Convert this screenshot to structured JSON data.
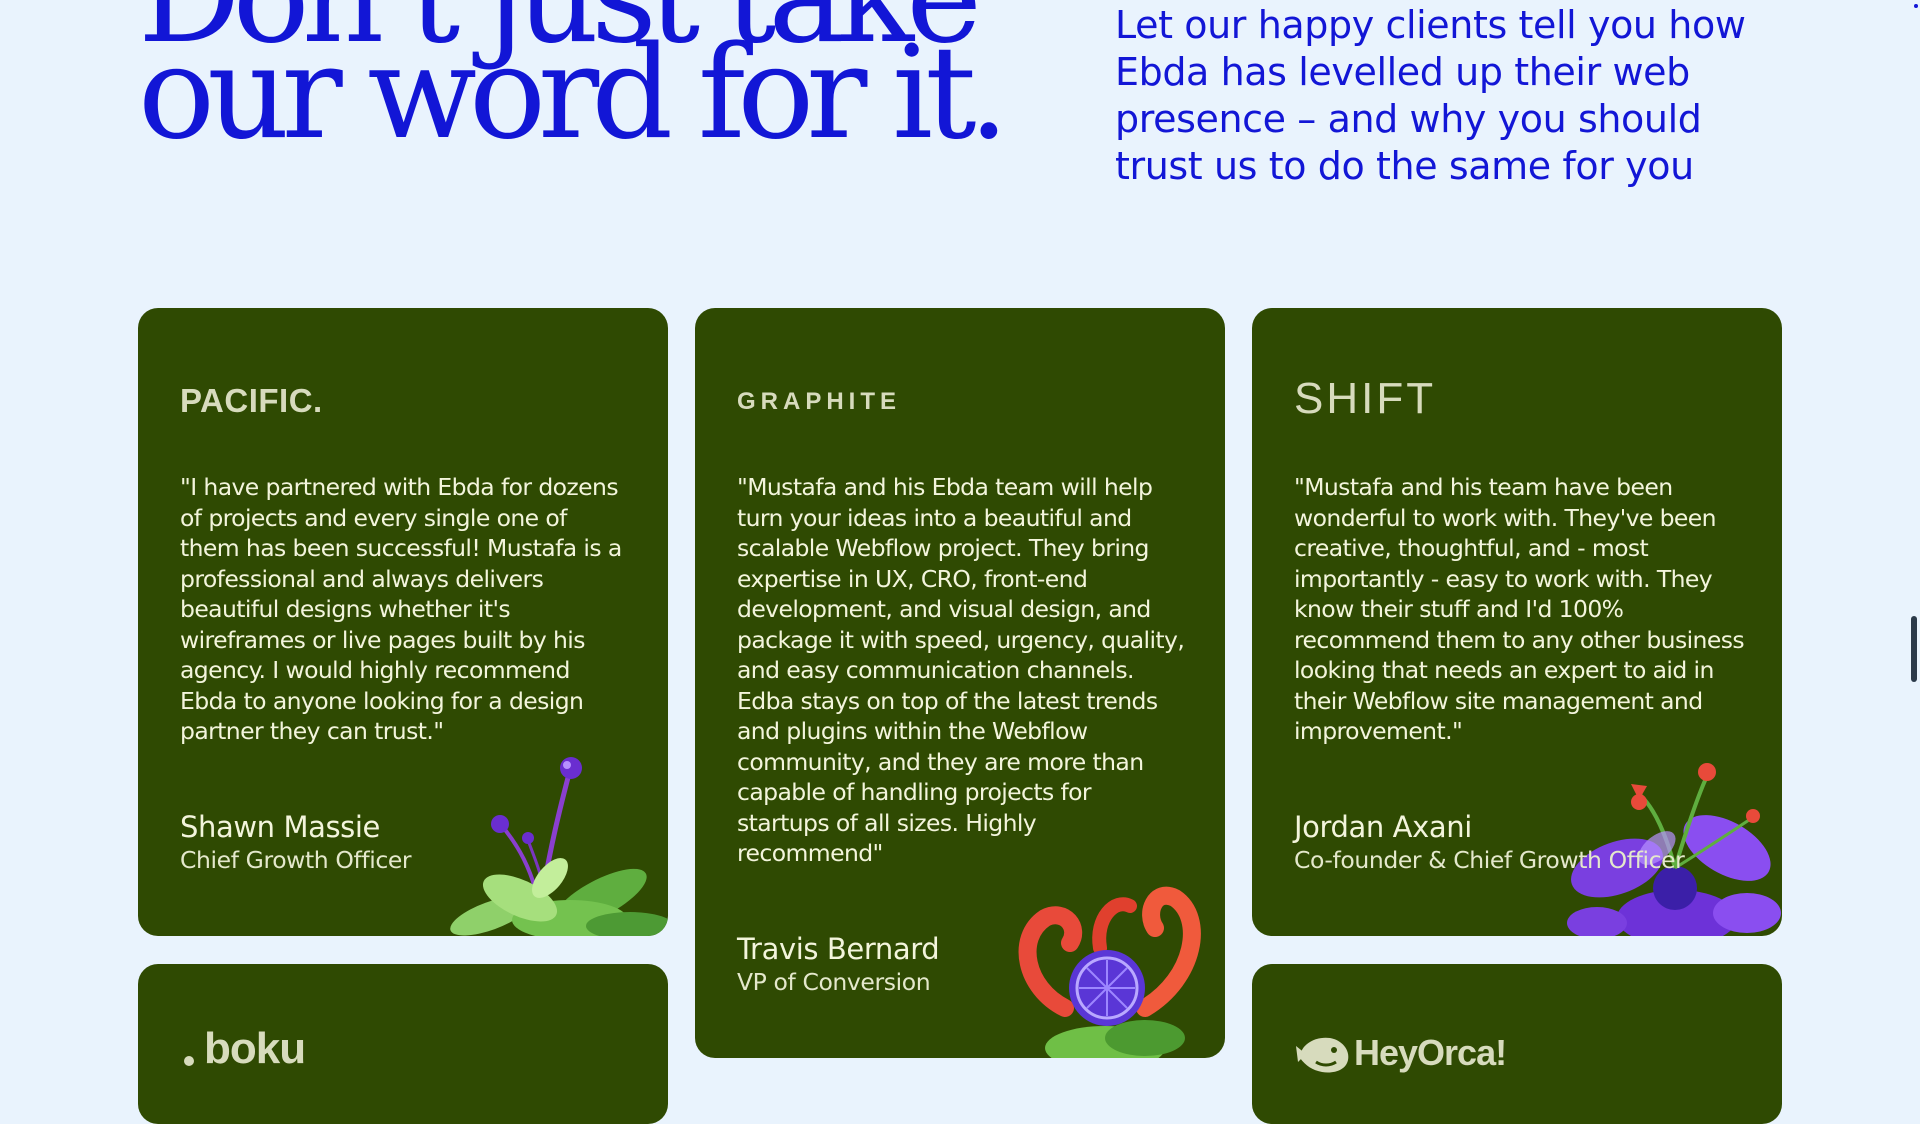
{
  "hero": {
    "title_line1": "Don’t just take",
    "title_line2": "our word for it.",
    "subtitle": "Let our happy clients tell you how Ebda has levelled up their web presence – and why you should trust us to do the same for you"
  },
  "colors": {
    "background": "#e9f3fd",
    "accent_blue": "#1216d6",
    "card_green": "#2f4a02",
    "card_text": "#f3f5dc"
  },
  "testimonials": [
    {
      "logo": "PACIFIC.",
      "quote": "\"I have partnered with Ebda for dozens of projects and every single one of them has been successful! Mustafa is a professional and always delivers beautiful designs whether it's wireframes or live pages built by his agency. I would highly recommend Ebda to anyone looking for a design partner they can trust.\"",
      "name": "Shawn Massie",
      "role": "Chief Growth Officer",
      "decoration": "green-plant-icon"
    },
    {
      "logo": "GRAPHITE",
      "quote": "\"Mustafa and his Ebda team will help turn your ideas into a beautiful and scalable Webflow project. They bring expertise in UX, CRO, front-end development, and visual design, and package it with speed, urgency, quality, and easy communication channels. Edba stays on top of the latest trends and plugins within the Webflow community, and they are more than capable of handling projects for startups of all sizes. Highly recommend\"",
      "name": "Travis Bernard",
      "role": "VP of Conversion",
      "decoration": "red-flower-icon"
    },
    {
      "logo": "SHIFT",
      "quote": "\"Mustafa and his team have been wonderful to work with. They've been creative, thoughtful, and - most importantly - easy to work with. They know their stuff and I'd 100% recommend them to any other business looking that needs an expert to aid in their Webflow site management and improvement.\"",
      "name": "Jordan Axani",
      "role": "Co-founder & Chief Growth Officer",
      "decoration": "purple-flower-icon"
    }
  ],
  "partial_cards": [
    {
      "logo": "boku"
    },
    {
      "logo": "HeyOrca!"
    }
  ]
}
